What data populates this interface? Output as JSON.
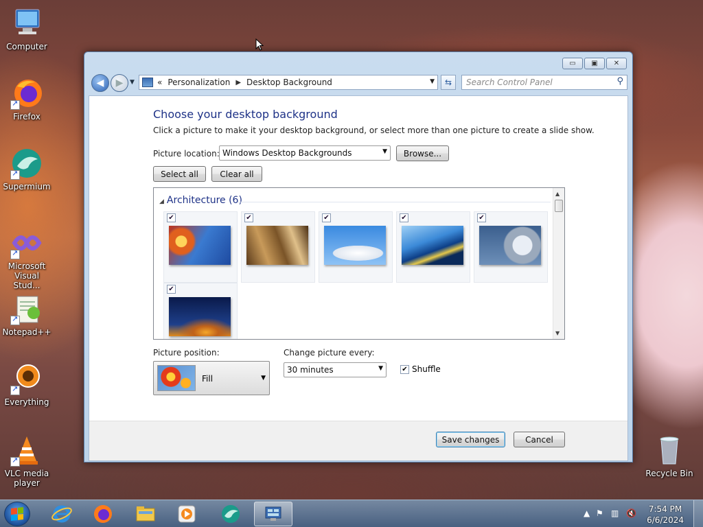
{
  "desktop": {
    "icons": [
      {
        "label": "Computer"
      },
      {
        "label": "Firefox"
      },
      {
        "label": "Supermium"
      },
      {
        "label": "Microsoft Visual Stud..."
      },
      {
        "label": "Notepad++"
      },
      {
        "label": "Everything"
      },
      {
        "label": "VLC media player"
      },
      {
        "label": "Recycle Bin"
      }
    ]
  },
  "window": {
    "controls": {
      "minimize": "▭",
      "maximize": "▣",
      "close": "✕"
    },
    "address": {
      "prefix": "«",
      "crumbs": [
        "Personalization",
        "Desktop Background"
      ]
    },
    "search": {
      "placeholder": "Search Control Panel"
    },
    "heading": "Choose your desktop background",
    "subheading": "Click a picture to make it your desktop background, or select more than one picture to create a slide show.",
    "picture_location": {
      "label": "Picture location:",
      "value": "Windows Desktop Backgrounds"
    },
    "browse_label": "Browse...",
    "select_all_label": "Select all",
    "clear_all_label": "Clear all",
    "gallery": {
      "group": {
        "name": "Architecture",
        "count": "(6)"
      },
      "thumbnails": [
        {
          "checked": true,
          "icon": "architecture-photo-1"
        },
        {
          "checked": true,
          "icon": "architecture-photo-2"
        },
        {
          "checked": true,
          "icon": "architecture-photo-3"
        },
        {
          "checked": true,
          "icon": "architecture-photo-4"
        },
        {
          "checked": true,
          "icon": "architecture-photo-5"
        },
        {
          "checked": true,
          "icon": "architecture-photo-6"
        }
      ]
    },
    "picture_position": {
      "label": "Picture position:",
      "value": "Fill"
    },
    "change_every": {
      "label": "Change picture every:",
      "value": "30 minutes"
    },
    "shuffle": {
      "label": "Shuffle",
      "checked": true
    },
    "save_label": "Save changes",
    "cancel_label": "Cancel"
  },
  "taskbar": {
    "apps": [
      "Internet Explorer",
      "Firefox",
      "File Explorer",
      "Media Player",
      "Supermium",
      "Control Panel"
    ],
    "clock": {
      "time": "7:54 PM",
      "date": "6/6/2024"
    }
  }
}
